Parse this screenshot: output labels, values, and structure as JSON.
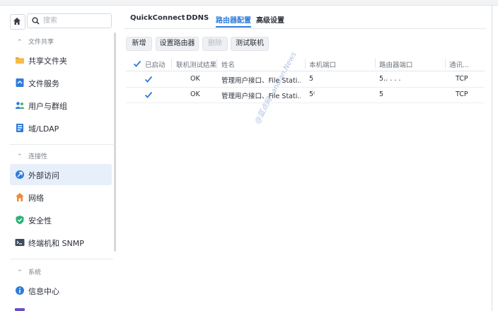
{
  "sidebar": {
    "search_placeholder": "搜索",
    "groups": [
      {
        "label": "文件共享",
        "items": [
          {
            "label": "共享文件夹"
          },
          {
            "label": "文件服务"
          },
          {
            "label": "用户与群组"
          },
          {
            "label": "域/LDAP"
          }
        ]
      },
      {
        "label": "连接性",
        "items": [
          {
            "label": "外部访问",
            "active": true
          },
          {
            "label": "网络"
          },
          {
            "label": "安全性"
          },
          {
            "label": "终端机和 SNMP"
          }
        ]
      },
      {
        "label": "系统",
        "items": [
          {
            "label": "信息中心"
          }
        ]
      }
    ]
  },
  "tabs": [
    {
      "label": "QuickConnect"
    },
    {
      "label": "DDNS"
    },
    {
      "label": "路由器配置",
      "active": true
    },
    {
      "label": "高级设置"
    }
  ],
  "toolbar": {
    "add": "新增",
    "setup_router": "设置路由器",
    "delete": "删除",
    "test_connection": "测试联机"
  },
  "table": {
    "columns": [
      "已启动",
      "联机测试结果",
      "姓名",
      "本机端口",
      "路由器端口",
      "通讯..."
    ],
    "rows": [
      {
        "enabled": true,
        "result": "OK",
        "name": "管理用户接口、File Stati...",
        "local_port": "5",
        "router_port": "5‥ . . .",
        "protocol": "TCP"
      },
      {
        "enabled": true,
        "result": "OK",
        "name": "管理用户接口、File Stati...",
        "local_port": "5⁽",
        "router_port": "5",
        "protocol": "TCP"
      }
    ]
  },
  "watermark": "@蓝点网 Landian.News",
  "colors": {
    "accent": "#2f7bd9",
    "active_bg": "#e7effb"
  }
}
